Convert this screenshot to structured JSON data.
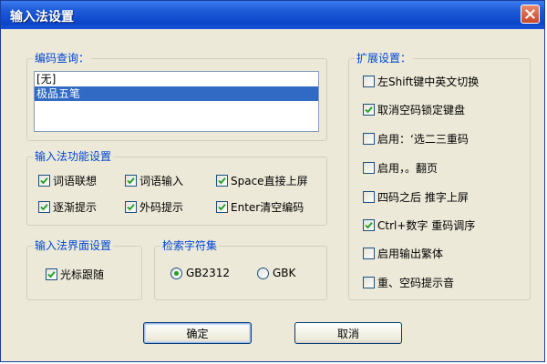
{
  "window": {
    "title": "输入法设置"
  },
  "code_query": {
    "title": "编码查询：",
    "items": [
      {
        "label": "[无]",
        "selected": false
      },
      {
        "label": "极品五笔",
        "selected": true
      }
    ]
  },
  "function_settings": {
    "title": "输入法功能设置",
    "options": [
      {
        "label": "词语联想",
        "checked": true
      },
      {
        "label": "词语输入",
        "checked": true
      },
      {
        "label": "Space直接上屏",
        "checked": true
      },
      {
        "label": "逐渐提示",
        "checked": true
      },
      {
        "label": "外码提示",
        "checked": true
      },
      {
        "label": "Enter清空编码",
        "checked": true
      }
    ]
  },
  "interface_settings": {
    "title": "输入法界面设置",
    "options": [
      {
        "label": "光标跟随",
        "checked": true
      }
    ]
  },
  "charset": {
    "title": "检索字符集",
    "options": [
      {
        "label": "GB2312",
        "selected": true
      },
      {
        "label": "GBK",
        "selected": false
      }
    ]
  },
  "extended_settings": {
    "title": "扩展设置：",
    "options": [
      {
        "label": "左Shift键中英文切换",
        "checked": false
      },
      {
        "label": "取消空码锁定键盘",
        "checked": true
      },
      {
        "label": "启用：‘选二三重码",
        "checked": false
      },
      {
        "label": "启用，。翻页",
        "checked": false
      },
      {
        "label": "四码之后 推字上屏",
        "checked": false
      },
      {
        "label": "Ctrl+数字 重码调序",
        "checked": true
      },
      {
        "label": "启用输出繁体",
        "checked": false
      },
      {
        "label": "重、空码提示音",
        "checked": false
      }
    ]
  },
  "buttons": {
    "ok": "确定",
    "cancel": "取消"
  }
}
